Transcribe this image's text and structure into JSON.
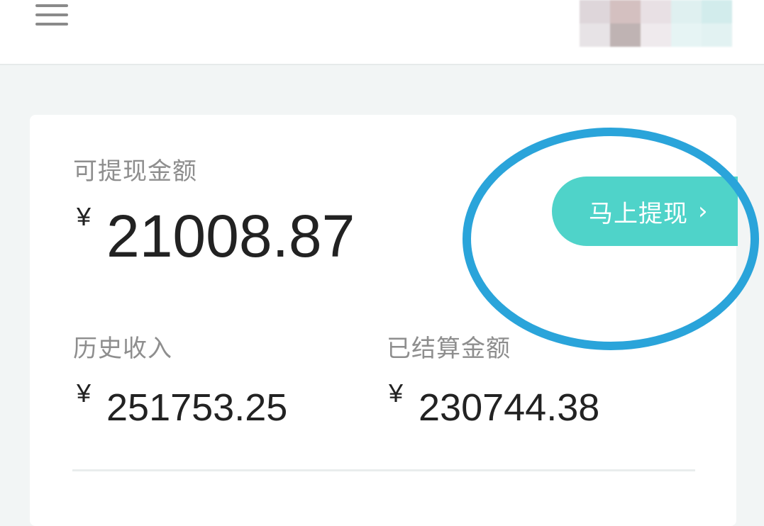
{
  "header": {
    "menu_icon": "hamburger-menu-icon",
    "avatar_colors": [
      "#ded6da",
      "#d4c0c0",
      "#e8e0e4",
      "#dff0f0",
      "#d2ecec",
      "#e7e3e6",
      "#bfb3b3",
      "#efeaed",
      "#e6f4f4",
      "#e2f2f2"
    ]
  },
  "balance": {
    "withdrawable_label": "可提现金额",
    "withdrawable_currency": "¥",
    "withdrawable_amount": "21008.87",
    "history_label": "历史收入",
    "history_currency": "¥",
    "history_amount": "251753.25",
    "settled_label": "已结算金额",
    "settled_currency": "¥",
    "settled_amount": "230744.38"
  },
  "actions": {
    "withdraw_label": "马上提现",
    "withdraw_icon": "chevron-right-icon"
  },
  "colors": {
    "accent": "#4fd3c9",
    "highlight": "#2aa4da",
    "background": "#f2f5f5"
  }
}
